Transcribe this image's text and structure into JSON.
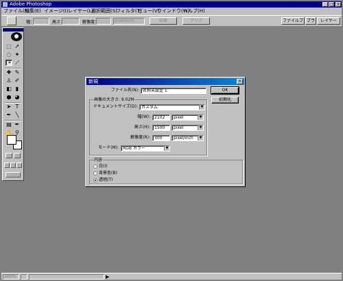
{
  "window": {
    "title": "Adobe Photoshop",
    "min": "_",
    "max": "□",
    "close": "×"
  },
  "menubar": {
    "items": [
      "ファイル(F)",
      "編集(E)",
      "イメージ(I)",
      "レイヤー(L)",
      "選択範囲(S)",
      "フィルタ(T)",
      "ビュー(V)",
      "ウインドウ(W)",
      "ヘルプ(H)"
    ]
  },
  "options": {
    "width_label": "幅：",
    "height_label": "高さ：",
    "resolution_label": "解像度：",
    "resolution_unit": "pixel/inch",
    "front_button": "前面",
    "clear_button": "クリア",
    "tabs": [
      "ファイルブ",
      "ブラ",
      "レイヤー"
    ]
  },
  "dialog": {
    "title": "新規",
    "name_label": "ファイル名(N):",
    "name_value": "名称未設定 1",
    "ok": "OK",
    "reset": "初期化",
    "size_group": "画像の大きさ: 9.02M",
    "doc_size_label": "ドキュメントサイズ(D):",
    "doc_size_value": "カスタム",
    "width_label": "幅(W):",
    "width_value": "2102",
    "width_unit": "pixel",
    "height_label": "高さ(H):",
    "height_value": "1500",
    "height_unit": "pixel",
    "resolution_label": "解像度(R):",
    "resolution_value": "300",
    "resolution_unit": "pixel/inch",
    "mode_label": "モード(M):",
    "mode_value": "RGB カラー",
    "contents_group": "内容",
    "contents": [
      {
        "label": "白(I)",
        "selected": false
      },
      {
        "label": "背景色(B)",
        "selected": false
      },
      {
        "label": "透明(T)",
        "selected": true
      }
    ]
  },
  "status": {
    "zoom": "100%",
    "info": ""
  }
}
